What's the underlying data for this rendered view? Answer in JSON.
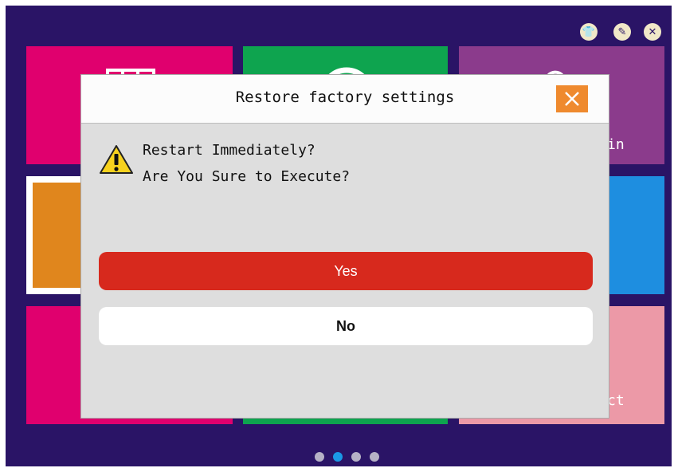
{
  "header_icons": [
    {
      "name": "shirt-icon",
      "glyph": "👕"
    },
    {
      "name": "edit-icon",
      "glyph": "✎"
    },
    {
      "name": "close-circle-icon",
      "glyph": "✕"
    }
  ],
  "tiles": [
    {
      "name": "tile-top-left",
      "color": "#e0006e"
    },
    {
      "name": "tile-top-middle",
      "color": "#0ea44f"
    },
    {
      "name": "tile-top-right",
      "color": "#8b3b8c",
      "label_partial": "in"
    },
    {
      "name": "tile-mid-left-selected",
      "color": "#e0861d"
    },
    {
      "name": "tile-mid-right",
      "color": "#1e8ee0"
    },
    {
      "name": "tile-bottom-left",
      "color": "#e0006e"
    },
    {
      "name": "tile-bottom-middle",
      "color": "#0ea44f"
    },
    {
      "name": "tile-bottom-right",
      "color": "#ec99a7",
      "label_partial": "ct"
    }
  ],
  "page_dots": {
    "count": 4,
    "active_index": 1
  },
  "dialog": {
    "title": "Restore factory settings",
    "message_line1": "Restart Immediately?",
    "message_line2": "Are You Sure to Execute?",
    "yes_label": "Yes",
    "no_label": "No",
    "icons": {
      "close": "close-icon",
      "warning": "warning-icon"
    }
  },
  "colors": {
    "background": "#2a1466",
    "yes_button": "#d7291d",
    "close_button": "#ef8a2e",
    "active_dot": "#1a98e6"
  }
}
